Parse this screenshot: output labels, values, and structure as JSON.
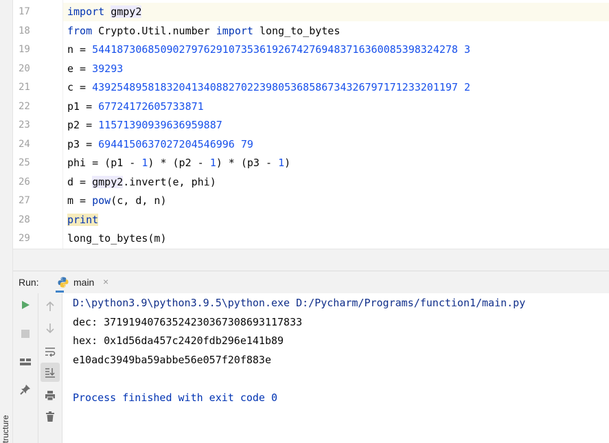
{
  "side_panel": {
    "label": "tructure"
  },
  "editor": {
    "lines": [
      {
        "n": "17",
        "parts": [
          {
            "t": "import",
            "c": "kw"
          },
          {
            "t": " "
          },
          {
            "t": "gmpy2",
            "c": "mod"
          }
        ]
      },
      {
        "n": "18",
        "parts": [
          {
            "t": "from",
            "c": "kw"
          },
          {
            "t": " Crypto.Util.number "
          },
          {
            "t": "import",
            "c": "kw"
          },
          {
            "t": " long_to_bytes"
          }
        ]
      },
      {
        "n": "19",
        "parts": [
          {
            "t": "n = "
          },
          {
            "t": "54418730685090279762910735361926742769483716360085398324278 3",
            "c": "num"
          }
        ]
      },
      {
        "n": "20",
        "parts": [
          {
            "t": "e = "
          },
          {
            "t": "39293",
            "c": "num"
          }
        ]
      },
      {
        "n": "21",
        "parts": [
          {
            "t": "c = "
          },
          {
            "t": "43925489581832041340882702239805368586734326797171233201197 2",
            "c": "num"
          }
        ]
      },
      {
        "n": "22",
        "parts": [
          {
            "t": "p1 = "
          },
          {
            "t": "67724172605733871",
            "c": "num"
          }
        ]
      },
      {
        "n": "23",
        "parts": [
          {
            "t": "p2 = "
          },
          {
            "t": "11571390939636959887",
            "c": "num"
          }
        ]
      },
      {
        "n": "24",
        "parts": [
          {
            "t": "p3 = "
          },
          {
            "t": "6944150637027204546996 79",
            "c": "num"
          }
        ]
      },
      {
        "n": "25",
        "parts": [
          {
            "t": "phi = (p1 - "
          },
          {
            "t": "1",
            "c": "num"
          },
          {
            "t": ") * (p2 - "
          },
          {
            "t": "1",
            "c": "num"
          },
          {
            "t": ") * (p3 - "
          },
          {
            "t": "1",
            "c": "num"
          },
          {
            "t": ")"
          }
        ]
      },
      {
        "n": "26",
        "parts": [
          {
            "t": "d = "
          },
          {
            "t": "gmpy2",
            "c": "mod"
          },
          {
            "t": ".invert(e, phi)"
          }
        ]
      },
      {
        "n": "27",
        "parts": [
          {
            "t": "m = "
          },
          {
            "t": "pow",
            "c": "kw"
          },
          {
            "t": "(c, d, n)"
          }
        ]
      },
      {
        "n": "28",
        "parts": [
          {
            "t": "print",
            "c": "kw warn"
          }
        ]
      },
      {
        "n": "29",
        "parts": [
          {
            "t": "long_to_bytes(m)"
          }
        ]
      }
    ]
  },
  "run": {
    "label": "Run:",
    "tab_name": "main",
    "tab_close": "×"
  },
  "console": {
    "lines": [
      {
        "t": "D:\\python3.9\\python3.9.5\\python.exe D:/Pycharm/Programs/function1/main.py",
        "c": "path"
      },
      {
        "t": "dec: 37191940763524230367308693117833",
        "c": ""
      },
      {
        "t": "hex: 0x1d56da457c2420fdb296e141b89",
        "c": ""
      },
      {
        "t": "e10adc3949ba59abbe56e057f20f883e",
        "c": ""
      },
      {
        "t": "",
        "c": ""
      },
      {
        "t": "Process finished with exit code 0",
        "c": "blue"
      }
    ]
  },
  "toolbar": {
    "col1": [
      "run-icon",
      "stop-icon",
      "layout-icon",
      "pin-icon"
    ],
    "col2": [
      "up-arrow-icon",
      "down-arrow-icon",
      "soft-wrap-icon",
      "scroll-to-end-icon",
      "print-icon",
      "trash-icon"
    ]
  }
}
